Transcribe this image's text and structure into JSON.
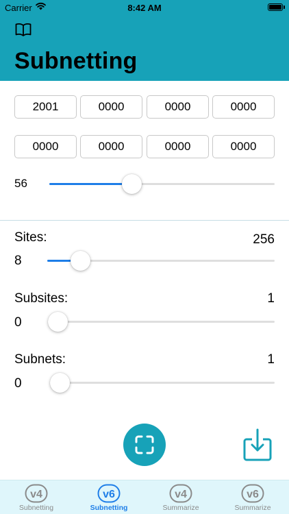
{
  "status_bar": {
    "carrier": "Carrier",
    "time": "8:42 AM"
  },
  "header": {
    "title": "Subnetting"
  },
  "address": {
    "segments": [
      "2001",
      "0000",
      "0000",
      "0000",
      "0000",
      "0000",
      "0000",
      "0000"
    ]
  },
  "prefix": {
    "value": "56",
    "level": 0.365
  },
  "sites": {
    "label": "Sites:",
    "value": "8",
    "max": "256",
    "level": 0.145
  },
  "subsites": {
    "label": "Subsites:",
    "value": "0",
    "max": "1",
    "level": 0.0
  },
  "subnets": {
    "label": "Subnets:",
    "value": "0",
    "max": "1",
    "level": 0.0
  },
  "tabs": [
    {
      "badge": "v4",
      "label": "Subnetting",
      "active": false
    },
    {
      "badge": "v6",
      "label": "Subnetting",
      "active": true
    },
    {
      "badge": "v4",
      "label": "Summarize",
      "active": false
    },
    {
      "badge": "v6",
      "label": "Summarize",
      "active": false
    }
  ],
  "colors": {
    "accent": "#17a2b8",
    "slider": "#1e7ee8",
    "active_tab": "#1e7ee8",
    "inactive_tab": "#8a8a8a"
  }
}
